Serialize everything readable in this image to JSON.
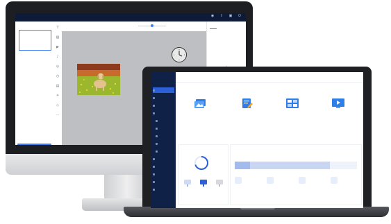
{
  "editor": {
    "title": "",
    "top_buttons": [
      {
        "label": "",
        "icon": "eye-icon"
      },
      {
        "label": "",
        "icon": "share-icon"
      },
      {
        "label": "",
        "icon": "save-icon"
      },
      {
        "label": "",
        "icon": "exit-icon"
      }
    ],
    "pages_title": "",
    "page_thumb_label": "",
    "add_page_label": "",
    "toolbar_items": [
      "",
      "",
      ""
    ],
    "right_tabs": [
      "",
      ""
    ],
    "property_label": "",
    "add_icon": "plus-icon"
  },
  "dashboard": {
    "logo": "",
    "nav": [
      {
        "label": "",
        "sub": false,
        "active": true
      },
      {
        "label": "",
        "sub": false,
        "active": false
      },
      {
        "label": "",
        "sub": false,
        "active": false
      },
      {
        "label": "",
        "sub": false,
        "active": false
      },
      {
        "label": "",
        "sub": true,
        "active": false
      },
      {
        "label": "",
        "sub": true,
        "active": false
      },
      {
        "label": "",
        "sub": true,
        "active": false
      },
      {
        "label": "",
        "sub": true,
        "active": false
      },
      {
        "label": "",
        "sub": true,
        "active": false
      },
      {
        "label": "",
        "sub": false,
        "active": false
      },
      {
        "label": "",
        "sub": false,
        "active": false
      },
      {
        "label": "",
        "sub": false,
        "active": false
      },
      {
        "label": "",
        "sub": false,
        "active": false
      },
      {
        "label": "",
        "sub": false,
        "active": false
      }
    ],
    "top": {
      "left_text": "",
      "right_texts": [
        "",
        "",
        ""
      ]
    },
    "steps": [
      {
        "step": "",
        "name": "",
        "desc": "",
        "icon": "image-stack-icon"
      },
      {
        "step": "",
        "name": "",
        "desc": "",
        "icon": "edit-document-icon"
      },
      {
        "step": "",
        "name": "",
        "desc": "",
        "icon": "grid-layout-icon"
      },
      {
        "step": "",
        "name": "",
        "desc": "",
        "icon": "play-screen-icon"
      }
    ],
    "device_card": {
      "title": "",
      "ring_fraction": 0.7,
      "devices": [
        {
          "label": "",
          "icon": "monitor-icon"
        },
        {
          "label": "",
          "icon": "monitor-icon"
        },
        {
          "label": "",
          "icon": "monitor-icon"
        }
      ]
    },
    "storage_card": {
      "title": "",
      "usage_title": "",
      "legend": [
        "",
        "",
        ""
      ],
      "usage_fraction": 0.78,
      "stats": [
        {
          "label": "",
          "value": "",
          "icon": "image-icon"
        },
        {
          "label": "",
          "value": "",
          "icon": "video-icon"
        },
        {
          "label": "",
          "value": "",
          "icon": "audio-icon"
        },
        {
          "label": "",
          "value": "",
          "icon": "file-icon"
        }
      ]
    },
    "colors": {
      "sidebar": "#0f2147",
      "accent": "#2d5fd6",
      "step_icon": "#2f7ee8"
    }
  }
}
